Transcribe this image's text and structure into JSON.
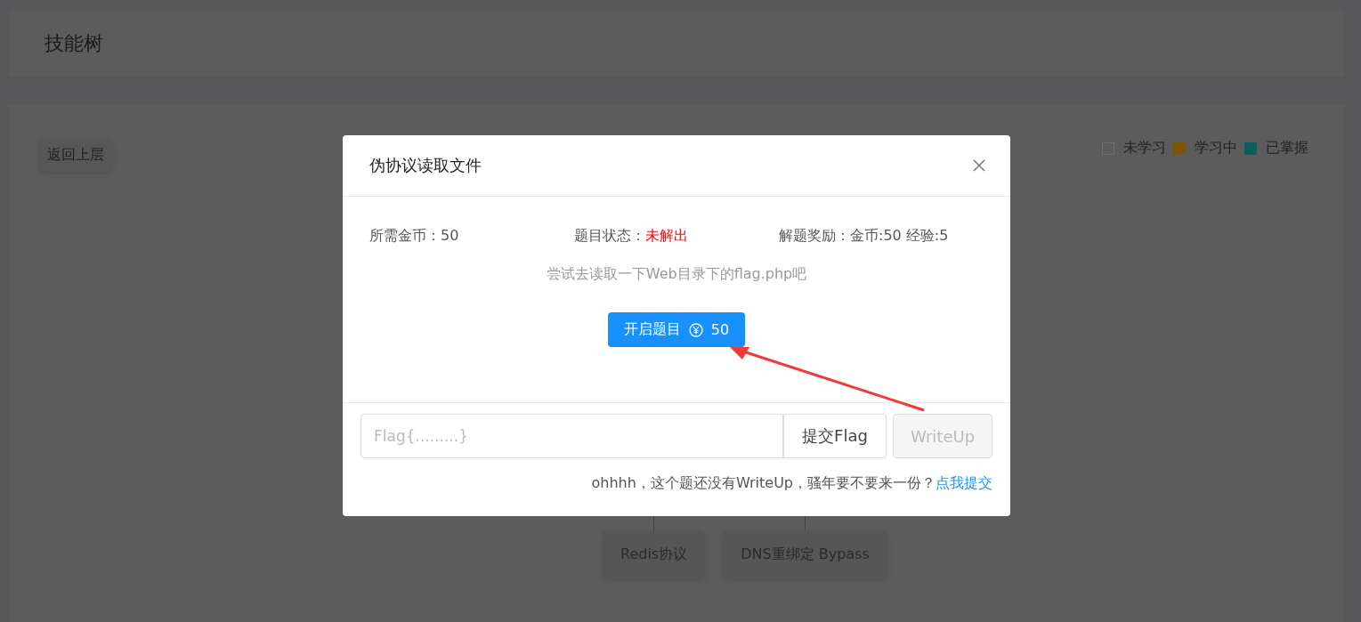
{
  "page_title": "技能树",
  "back_button": "返回上层",
  "legend": [
    {
      "label": "未学习",
      "kind": "outline",
      "color": "#6e6e6e"
    },
    {
      "label": "学习中",
      "kind": "filled",
      "color": "#7a5408"
    },
    {
      "label": "已掌握",
      "kind": "filled",
      "color": "#0b5f5b"
    }
  ],
  "tree_nodes": [
    {
      "label": "Redis协议"
    },
    {
      "label": "DNS重绑定 Bypass"
    }
  ],
  "dialog": {
    "title": "伪协议读取文件",
    "fields": [
      {
        "label": "所需金币：",
        "value": "50",
        "kind": "plain"
      },
      {
        "label": "题目状态：",
        "value": "未解出",
        "kind": "alert"
      },
      {
        "label": "解题奖励：",
        "value": "金币:50 经验:5",
        "kind": "plain"
      }
    ],
    "hint": "尝试去读取一下Web目录下的flag.php吧",
    "start_button": {
      "label": "开启题目",
      "cost": "50"
    },
    "flag_input": {
      "placeholder": "Flag{.........}"
    },
    "submit_button": "提交Flag",
    "writeup_button": {
      "label": "WriteUp",
      "disabled": true
    },
    "footer": {
      "text": "ohhhh，这个题还没有WriteUp，骚年要不要来一份？",
      "link": "点我提交"
    }
  }
}
